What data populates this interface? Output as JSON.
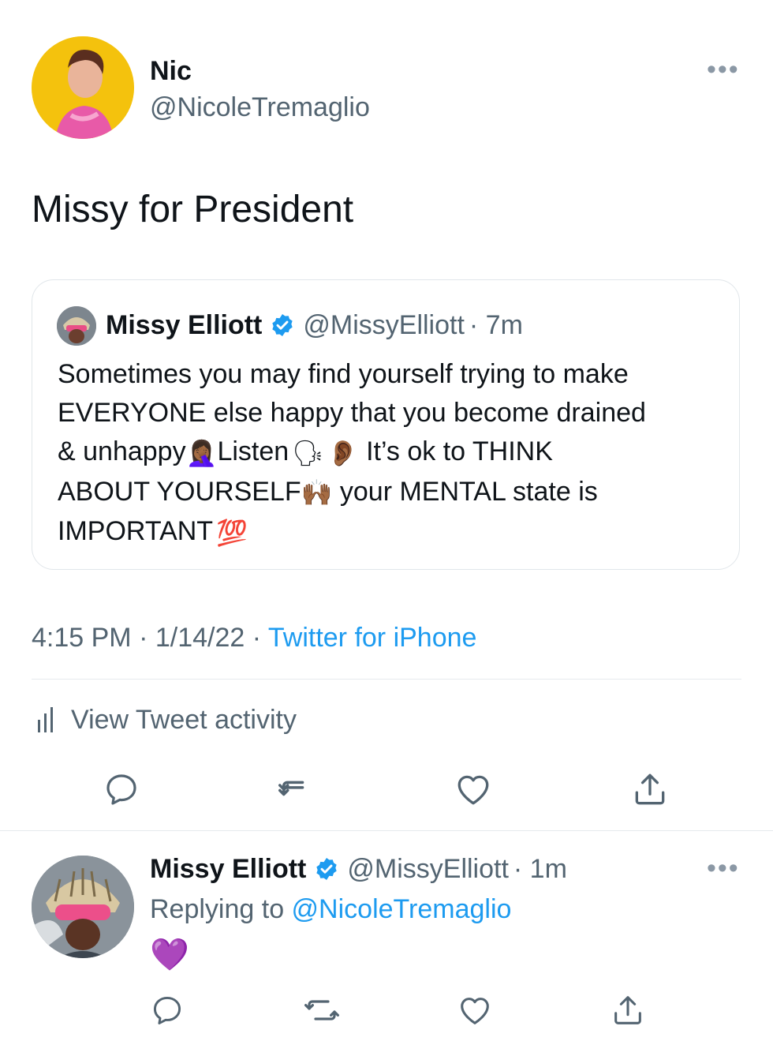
{
  "tweet": {
    "author_name": "Nic",
    "author_handle": "@NicoleTremaglio",
    "text": "Missy for President",
    "timestamp": "4:15 PM · 1/14/22 · ",
    "source": "Twitter for iPhone",
    "activity_label": "View Tweet activity"
  },
  "quote": {
    "author_name": "Missy Elliott",
    "author_handle": "@MissyElliott",
    "time": "· 7m",
    "line1": "Sometimes you may find yourself trying to make",
    "line2": "EVERYONE else happy that you become drained",
    "line3a": "& unhappy",
    "line3b": "Listen",
    "line3c": " It’s ok to THINK",
    "line4a": "ABOUT YOURSELF",
    "line4b": " your MENTAL state is",
    "line5a": "IMPORTANT",
    "emoji": {
      "facepalm": "🤦🏾‍♀️",
      "speaking": "🗣",
      "ear": "👂🏾",
      "raised_hands": "🙌🏾",
      "hundred": "💯"
    }
  },
  "reply": {
    "author_name": "Missy Elliott",
    "author_handle": "@MissyElliott",
    "time": "· 1m",
    "replying_prefix": "Replying to ",
    "replying_handle": "@NicoleTremaglio",
    "text": "💜"
  },
  "colors": {
    "accent": "#1d9bf0",
    "verified": "#1d9bf0",
    "secondary_text": "#536471",
    "heart_purple": "#9b4dea"
  }
}
